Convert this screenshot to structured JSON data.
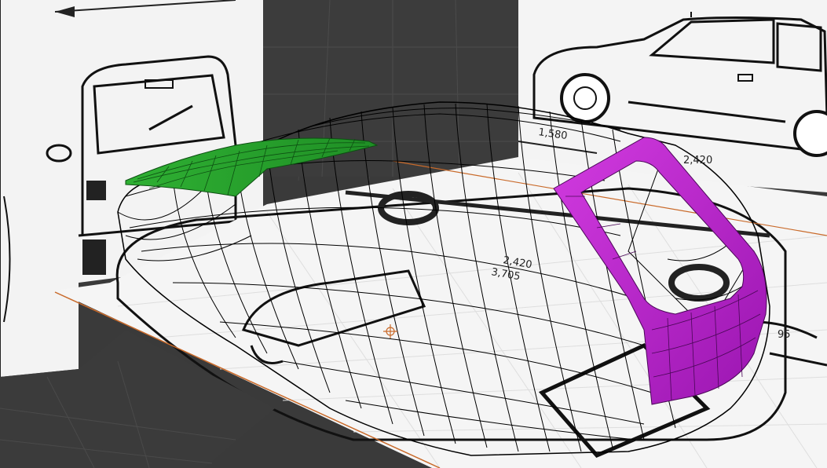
{
  "viewport": {
    "background": "#3a3a3a",
    "grid_color": "#505050",
    "paper_color": "#f4f4f4",
    "axis_x_color": "#c96a2a",
    "axis_y_color": "#7a2b2b",
    "wire_color": "#000000",
    "selected_green": "#28a02c",
    "selected_magenta": "#b41ec8"
  },
  "blueprints": {
    "side_view_dims": [
      "2,420"
    ],
    "top_view_dims": [
      "2,420",
      "3,705",
      "1,580"
    ],
    "right_view_dims": [
      "2,420",
      "3,705",
      "95"
    ]
  }
}
